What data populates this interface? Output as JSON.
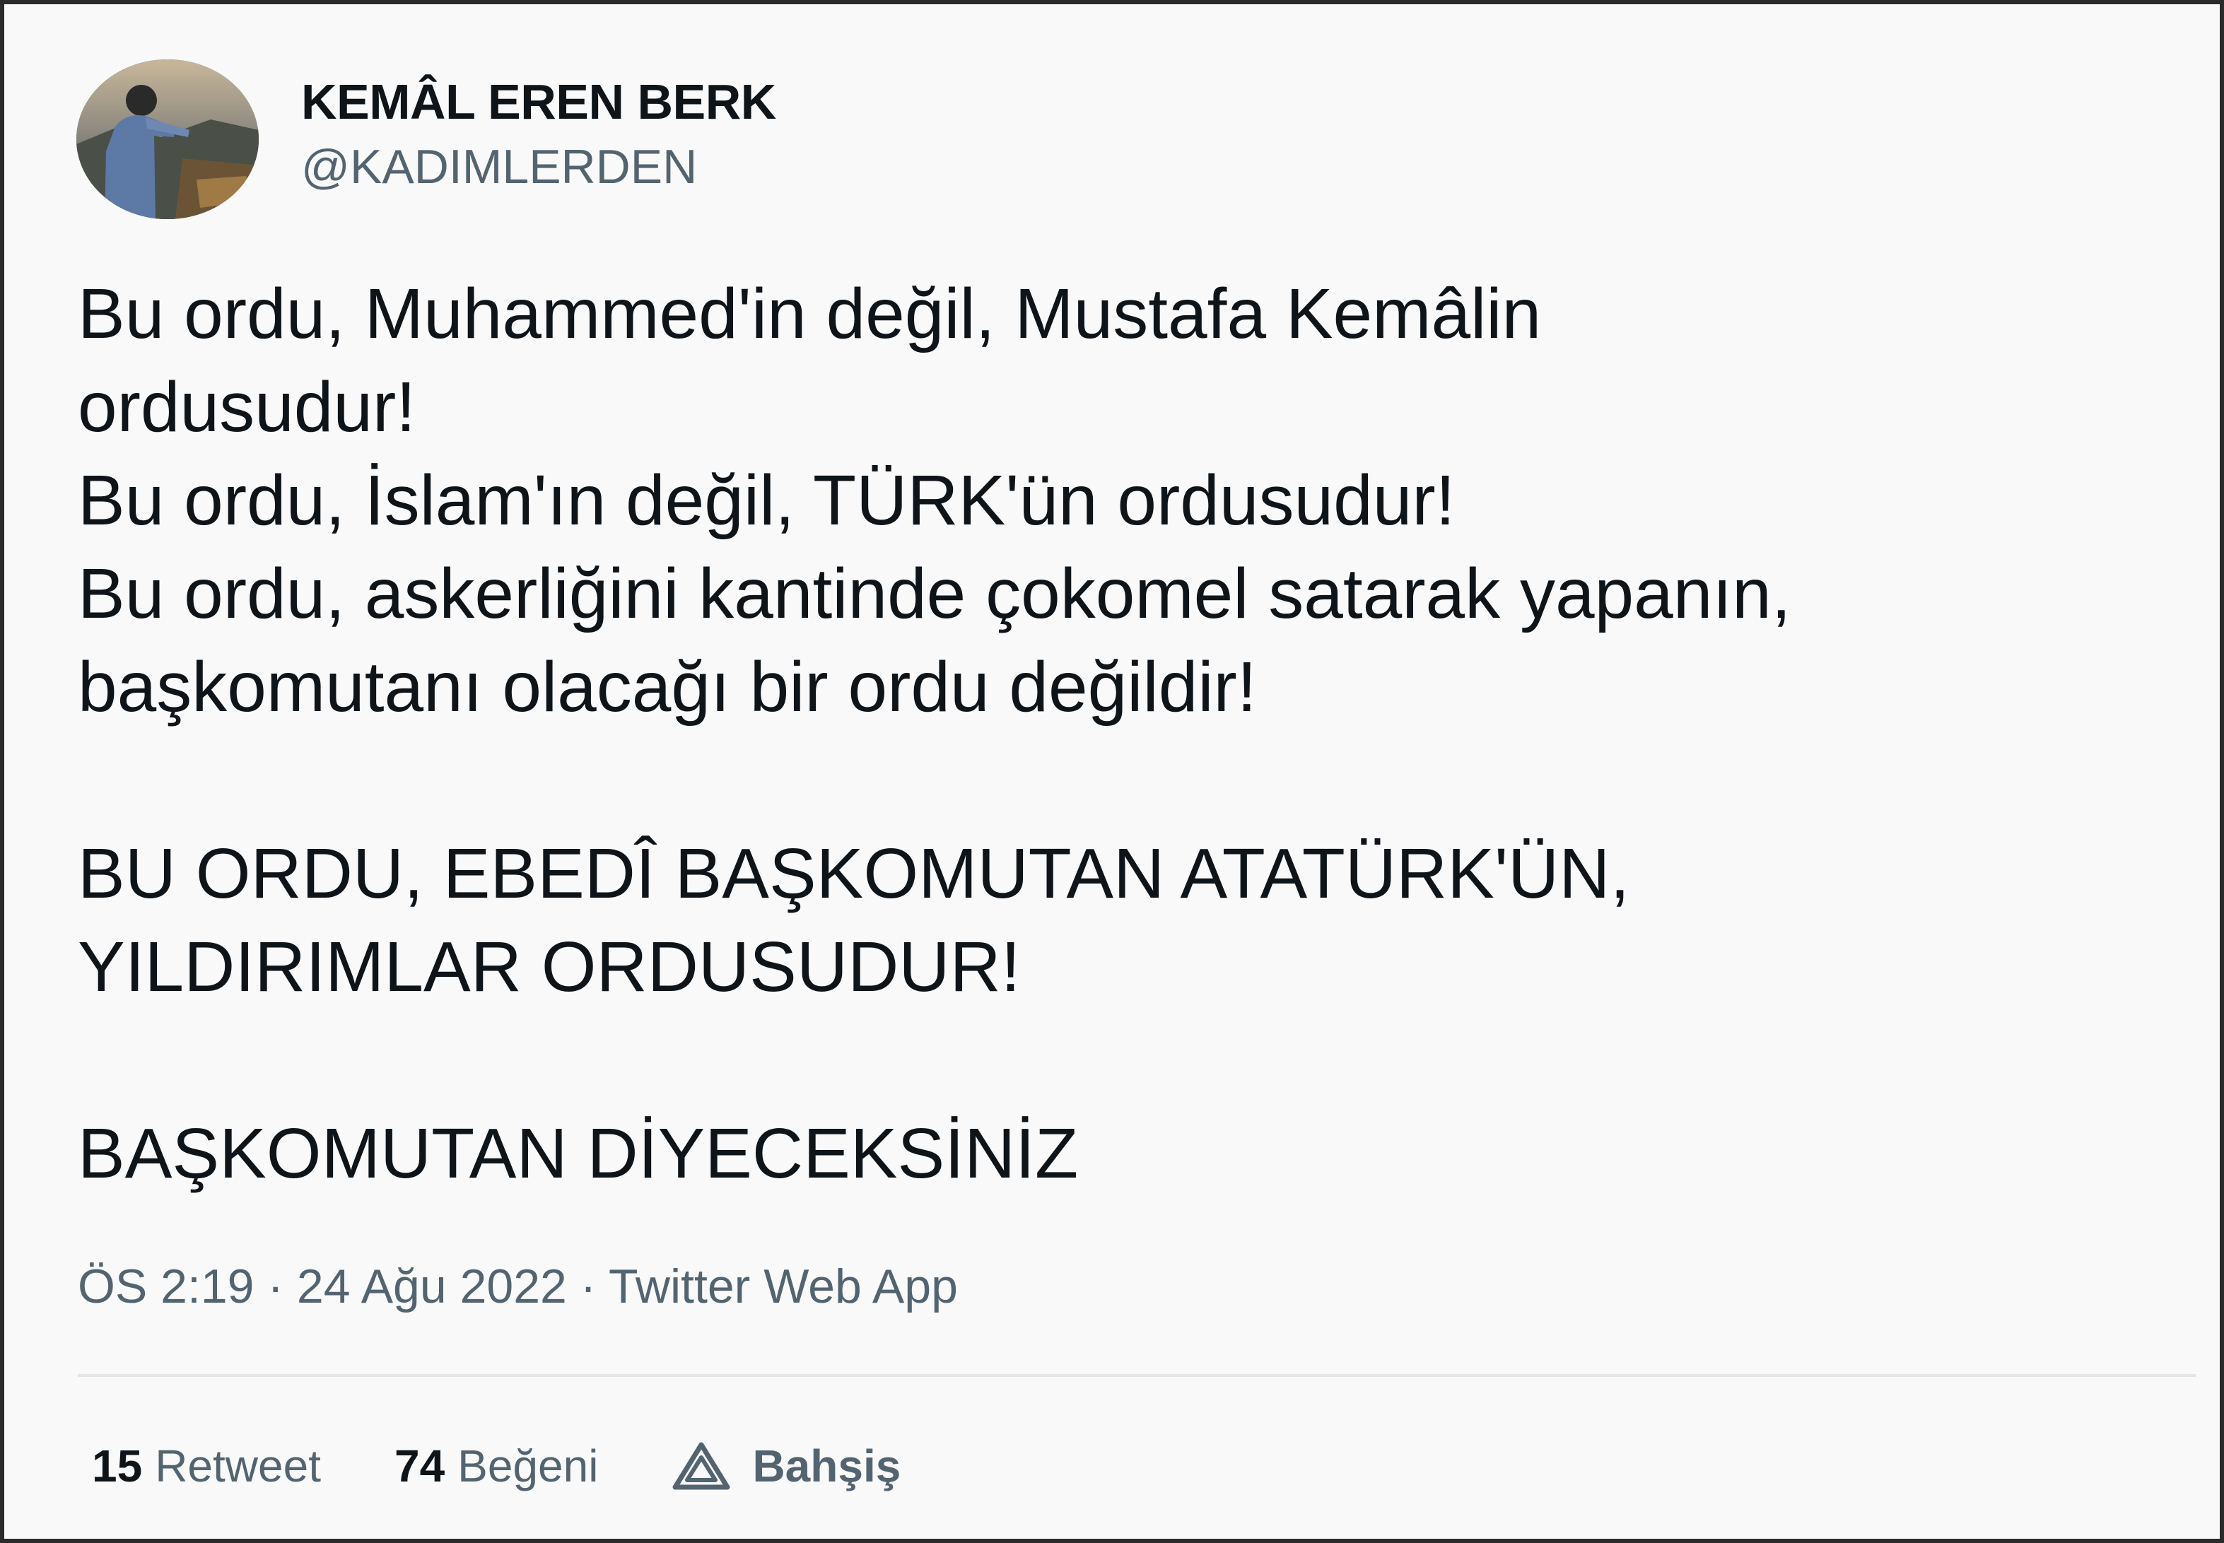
{
  "author": {
    "display_name": "KEMÂL EREN BERK",
    "handle": "@KADIMLERDEN",
    "avatar": "profile-photo"
  },
  "tweet": {
    "lines": [
      "Bu ordu, Muhammed'in değil, Mustafa Kemâlin",
      "ordusudur!",
      "Bu ordu, İslam'ın değil, TÜRK'ün ordusudur!",
      "Bu ordu, askerliğini kantinde çokomel satarak yapanın,",
      "başkomutanı olacağı bir ordu değildir!",
      "",
      "BU ORDU, EBEDÎ BAŞKOMUTAN ATATÜRK'ÜN,",
      "YILDIRIMLAR ORDUSUDUR!",
      "",
      "BAŞKOMUTAN DİYECEKSİNİZ"
    ]
  },
  "meta": {
    "line": "ÖS 2:19 · 24 Ağu 2022 · Twitter Web App"
  },
  "stats": {
    "retweets": {
      "count": "15",
      "label": "Retweet"
    },
    "likes": {
      "count": "74",
      "label": "Beğeni"
    },
    "tip": {
      "label": "Bahşiş",
      "icon": "tip-icon"
    }
  },
  "colors": {
    "text_primary": "#0f1419",
    "text_secondary": "#536471",
    "divider": "#e3e6e8",
    "background": "#f9f9fa"
  }
}
